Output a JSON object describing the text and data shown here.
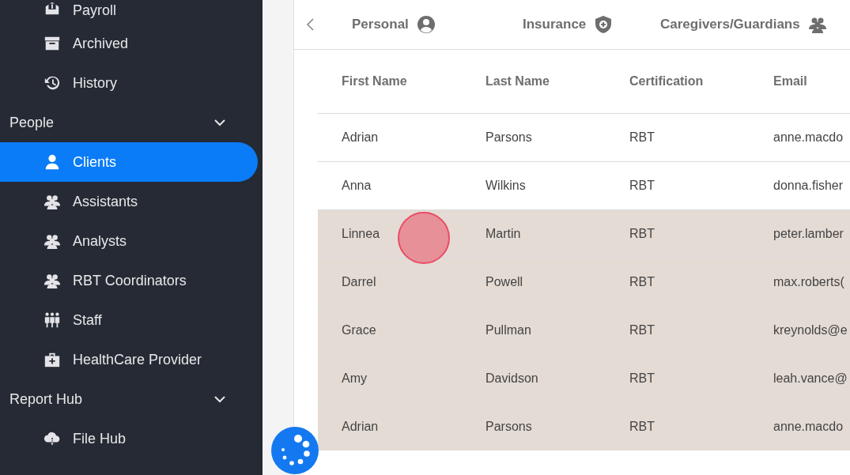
{
  "sidebar": {
    "items": [
      {
        "kind": "item",
        "label": "Payroll",
        "selected": false
      },
      {
        "kind": "item",
        "label": "Archived",
        "selected": false
      },
      {
        "kind": "item",
        "label": "History",
        "selected": false
      },
      {
        "kind": "section",
        "label": "People",
        "expanded": true
      },
      {
        "kind": "item",
        "label": "Clients",
        "selected": true
      },
      {
        "kind": "item",
        "label": "Assistants",
        "selected": false
      },
      {
        "kind": "item",
        "label": "Analysts",
        "selected": false
      },
      {
        "kind": "item",
        "label": "RBT Coordinators",
        "selected": false
      },
      {
        "kind": "item",
        "label": "Staff",
        "selected": false
      },
      {
        "kind": "item",
        "label": "HealthCare Provider",
        "selected": false
      },
      {
        "kind": "section",
        "label": "Report Hub",
        "expanded": true
      },
      {
        "kind": "item",
        "label": "File Hub",
        "selected": false
      }
    ]
  },
  "tabs": [
    {
      "label": "Personal"
    },
    {
      "label": "Insurance"
    },
    {
      "label": "Caregivers/Guardians"
    }
  ],
  "table": {
    "columns": [
      "First Name",
      "Last Name",
      "Certification",
      "Email"
    ],
    "rows": [
      {
        "cells": [
          "Adrian",
          "Parsons",
          "RBT",
          "anne.macdo"
        ],
        "highlighted": false
      },
      {
        "cells": [
          "Anna",
          "Wilkins",
          "RBT",
          "donna.fisher"
        ],
        "highlighted": false
      },
      {
        "cells": [
          "Linnea",
          "Martin",
          "RBT",
          "peter.lamber"
        ],
        "highlighted": true
      },
      {
        "cells": [
          "Darrel",
          "Powell",
          "RBT",
          "max.roberts("
        ],
        "highlighted": true
      },
      {
        "cells": [
          "Grace",
          "Pullman",
          "RBT",
          "kreynolds@e"
        ],
        "highlighted": true
      },
      {
        "cells": [
          "Amy",
          "Davidson",
          "RBT",
          "leah.vance@"
        ],
        "highlighted": true
      },
      {
        "cells": [
          "Adrian",
          "Parsons",
          "RBT",
          "anne.macdo"
        ],
        "highlighted": true
      }
    ]
  }
}
